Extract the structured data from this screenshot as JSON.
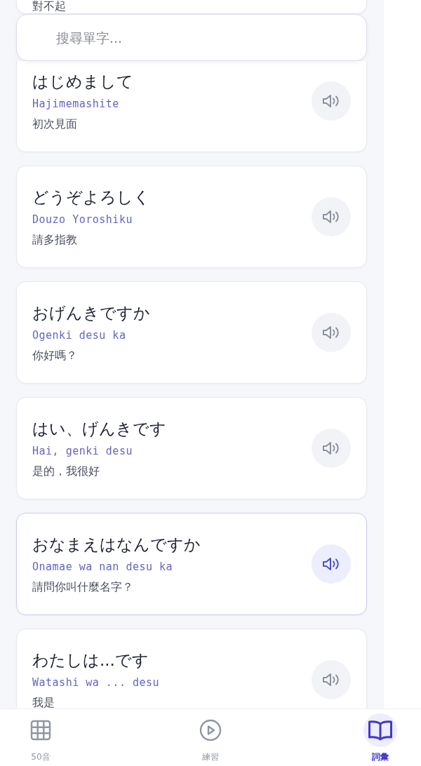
{
  "top_partial_card": {
    "translation": "對不起"
  },
  "search": {
    "placeholder": "搜尋單字..."
  },
  "phrases": [
    {
      "japanese": "はじめまして",
      "romaji": "Hajimemashite",
      "translation": "初次見面",
      "selected": false
    },
    {
      "japanese": "どうぞよろしく",
      "romaji": "Douzo Yoroshiku",
      "translation": "請多指教",
      "selected": false
    },
    {
      "japanese": "おげんきですか",
      "romaji": "Ogenki desu ka",
      "translation": "你好嗎？",
      "selected": false
    },
    {
      "japanese": "はい、げんきです",
      "romaji": "Hai, genki desu",
      "translation": "是的，我很好",
      "selected": false
    },
    {
      "japanese": "おなまえはなんですか",
      "romaji": "Onamae wa nan desu ka",
      "translation": "請問你叫什麼名字？",
      "selected": true
    },
    {
      "japanese": "わたしは...です",
      "romaji": "Watashi wa ... desu",
      "translation": "我是",
      "selected": false
    }
  ],
  "bottom_nav": [
    {
      "label": "50音",
      "kind": "grid",
      "selected": false
    },
    {
      "label": "練習",
      "kind": "play",
      "selected": false
    },
    {
      "label": "詞彙",
      "kind": "book",
      "selected": true
    }
  ]
}
